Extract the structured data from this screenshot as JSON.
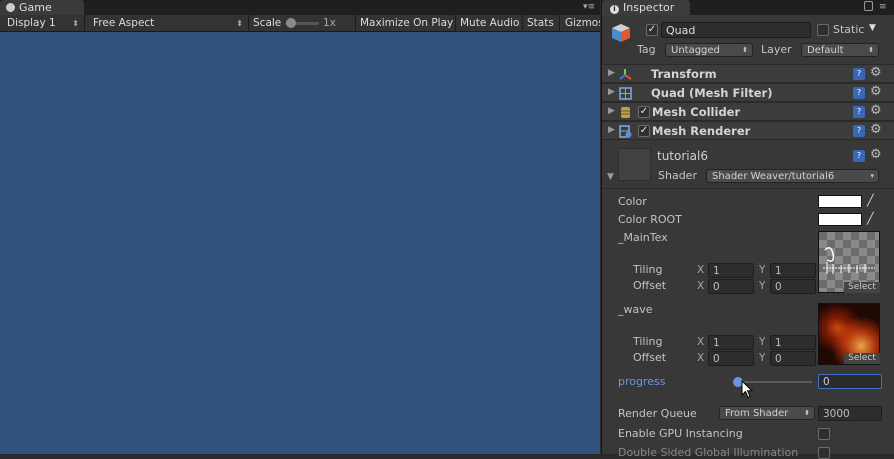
{
  "game": {
    "tab_label": "Game",
    "toolbar": {
      "display": "Display 1",
      "aspect": "Free Aspect",
      "scale_label": "Scale",
      "scale_value": "1x",
      "maximize": "Maximize On Play",
      "mute": "Mute Audio",
      "stats": "Stats",
      "gizmos": "Gizmos"
    },
    "background_color": "#30507e"
  },
  "inspector": {
    "tab_label": "Inspector",
    "object": {
      "name": "Quad",
      "active": true,
      "static_label": "Static",
      "tag_label": "Tag",
      "tag_value": "Untagged",
      "layer_label": "Layer",
      "layer_value": "Default"
    },
    "components": [
      {
        "name": "Transform",
        "icon": "transform-icon",
        "has_checkbox": false
      },
      {
        "name": "Quad (Mesh Filter)",
        "icon": "mesh-filter-icon",
        "has_checkbox": false
      },
      {
        "name": "Mesh Collider",
        "icon": "mesh-collider-icon",
        "has_checkbox": true
      },
      {
        "name": "Mesh Renderer",
        "icon": "mesh-renderer-icon",
        "has_checkbox": true
      }
    ],
    "material": {
      "name": "tutorial6",
      "shader_label": "Shader",
      "shader_value": "Shader Weaver/tutorial6",
      "color_label": "Color",
      "color_root_label": "Color ROOT",
      "color_value": "#ffffff",
      "maintex_label": "_MainTex",
      "wave_label": "_wave",
      "tiling_label": "Tiling",
      "offset_label": "Offset",
      "x_label": "X",
      "y_label": "Y",
      "maintex_tiling_x": "1",
      "maintex_tiling_y": "1",
      "maintex_offset_x": "0",
      "maintex_offset_y": "0",
      "wave_tiling_x": "1",
      "wave_tiling_y": "1",
      "wave_offset_x": "0",
      "wave_offset_y": "0",
      "select_label": "Select",
      "progress_label": "progress",
      "progress_value": "0",
      "progress_fraction": 0,
      "render_queue_label": "Render Queue",
      "render_queue_mode": "From Shader",
      "render_queue_value": "3000",
      "gpu_instancing_label": "Enable GPU Instancing",
      "double_sided_label": "Double Sided Global Illumination"
    }
  }
}
